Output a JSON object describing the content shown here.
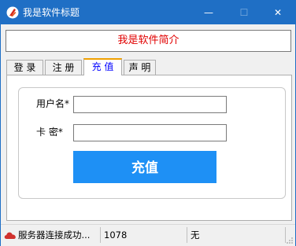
{
  "window": {
    "title": "我是软件标题",
    "min_glyph": "—",
    "max_glyph": "☐",
    "close_glyph": "✕"
  },
  "banner": {
    "text": "我是软件简介",
    "color": "#e10000"
  },
  "tabs": [
    {
      "label": "登 录",
      "selected": false
    },
    {
      "label": "注 册",
      "selected": false
    },
    {
      "label": "充 值",
      "selected": true
    },
    {
      "label": "声 明",
      "selected": false
    }
  ],
  "form": {
    "username_label": "用户名*",
    "username_value": "",
    "card_label": "卡 密*",
    "card_value": "",
    "submit_label": "充值"
  },
  "status": {
    "message": "服务器连接成功...",
    "count": "1078",
    "extra": "无"
  },
  "colors": {
    "titlebar": "#1f6fc5",
    "accent_button": "#1e90f5",
    "selected_tab_text": "#0000ff",
    "selected_tab_top": "#f0a000"
  },
  "icons": {
    "app": "app-logo-icon",
    "status": "cloud-icon"
  }
}
